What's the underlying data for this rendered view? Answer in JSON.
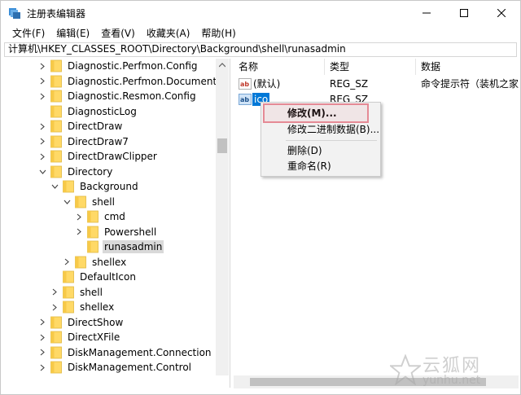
{
  "window": {
    "title": "注册表编辑器",
    "icon": "regedit-icon"
  },
  "menubar": [
    "文件(F)",
    "编辑(E)",
    "查看(V)",
    "收藏夹(A)",
    "帮助(H)"
  ],
  "address": "计算机\\HKEY_CLASSES_ROOT\\Directory\\Background\\shell\\runasadmin",
  "tree": [
    {
      "label": "Diagnostic.Perfmon.Config",
      "level": 0,
      "chev": "right"
    },
    {
      "label": "Diagnostic.Perfmon.Document",
      "level": 0,
      "chev": "right"
    },
    {
      "label": "Diagnostic.Resmon.Config",
      "level": 0,
      "chev": "right"
    },
    {
      "label": "DiagnosticLog",
      "level": 0,
      "chev": "none"
    },
    {
      "label": "DirectDraw",
      "level": 0,
      "chev": "right"
    },
    {
      "label": "DirectDraw7",
      "level": 0,
      "chev": "right"
    },
    {
      "label": "DirectDrawClipper",
      "level": 0,
      "chev": "right"
    },
    {
      "label": "Directory",
      "level": 0,
      "chev": "down"
    },
    {
      "label": "Background",
      "level": 1,
      "chev": "down"
    },
    {
      "label": "shell",
      "level": 2,
      "chev": "down"
    },
    {
      "label": "cmd",
      "level": 3,
      "chev": "right"
    },
    {
      "label": "Powershell",
      "level": 3,
      "chev": "right"
    },
    {
      "label": "runasadmin",
      "level": 3,
      "chev": "none",
      "selected": true
    },
    {
      "label": "shellex",
      "level": 2,
      "chev": "right"
    },
    {
      "label": "DefaultIcon",
      "level": 1,
      "chev": "none"
    },
    {
      "label": "shell",
      "level": 1,
      "chev": "right"
    },
    {
      "label": "shellex",
      "level": 1,
      "chev": "right"
    },
    {
      "label": "DirectShow",
      "level": 0,
      "chev": "right"
    },
    {
      "label": "DirectXFile",
      "level": 0,
      "chev": "right"
    },
    {
      "label": "DiskManagement.Connection",
      "level": 0,
      "chev": "right"
    },
    {
      "label": "DiskManagement.Control",
      "level": 0,
      "chev": "right"
    }
  ],
  "columns": {
    "name": "名称",
    "type": "类型",
    "data": "数据"
  },
  "values": [
    {
      "name": "(默认)",
      "type": "REG_SZ",
      "data": "命令提示符（装机之家"
    },
    {
      "name": "ico",
      "type": "REG_SZ",
      "data": ""
    }
  ],
  "context_menu": {
    "modify": "修改(M)...",
    "modify_binary": "修改二进制数据(B)...",
    "delete": "删除(D)",
    "rename": "重命名(R)"
  },
  "watermark": {
    "cn": "云狐网",
    "url": "yunhu.net"
  },
  "colors": {
    "folder": "#ffd966",
    "selection": "#0078d7",
    "highlight": "#e58a95"
  }
}
